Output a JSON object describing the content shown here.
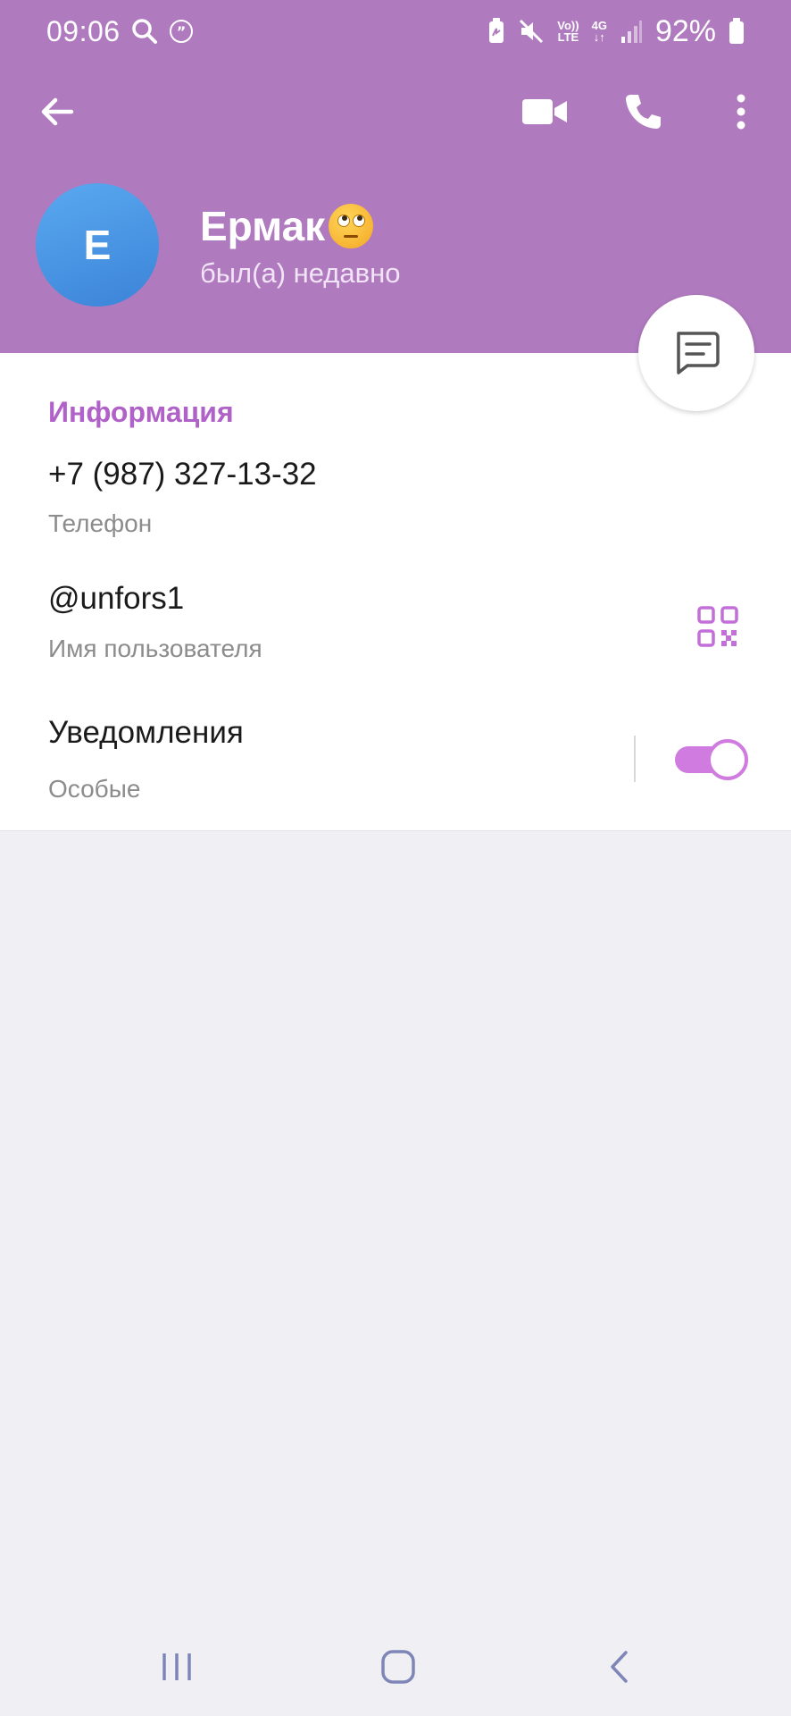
{
  "status_bar": {
    "time": "09:06",
    "network_label_top": "Vo))",
    "network_label_bottom": "LTE",
    "network_type": "4G",
    "battery_percent": "92%"
  },
  "app_bar": {
    "back_icon": "arrow-left-icon",
    "video_icon": "video-camera-icon",
    "call_icon": "phone-icon",
    "more_icon": "more-vertical-icon"
  },
  "profile": {
    "avatar_letter": "E",
    "name": "Ермак",
    "name_emoji": "face-with-rolling-eyes",
    "status": "был(а) недавно"
  },
  "fab": {
    "icon": "message-icon"
  },
  "info": {
    "section_title": "Информация",
    "phone_value": "+7 (987) 327-13-32",
    "phone_label": "Телефон",
    "username_value": "@unfors1",
    "username_label": "Имя пользователя",
    "notifications_value": "Уведомления",
    "notifications_label": "Особые",
    "notifications_enabled": true
  },
  "colors": {
    "header": "#b07abf",
    "accent": "#b062c8",
    "toggle": "#d07be0",
    "avatar": "#4a97e6"
  }
}
